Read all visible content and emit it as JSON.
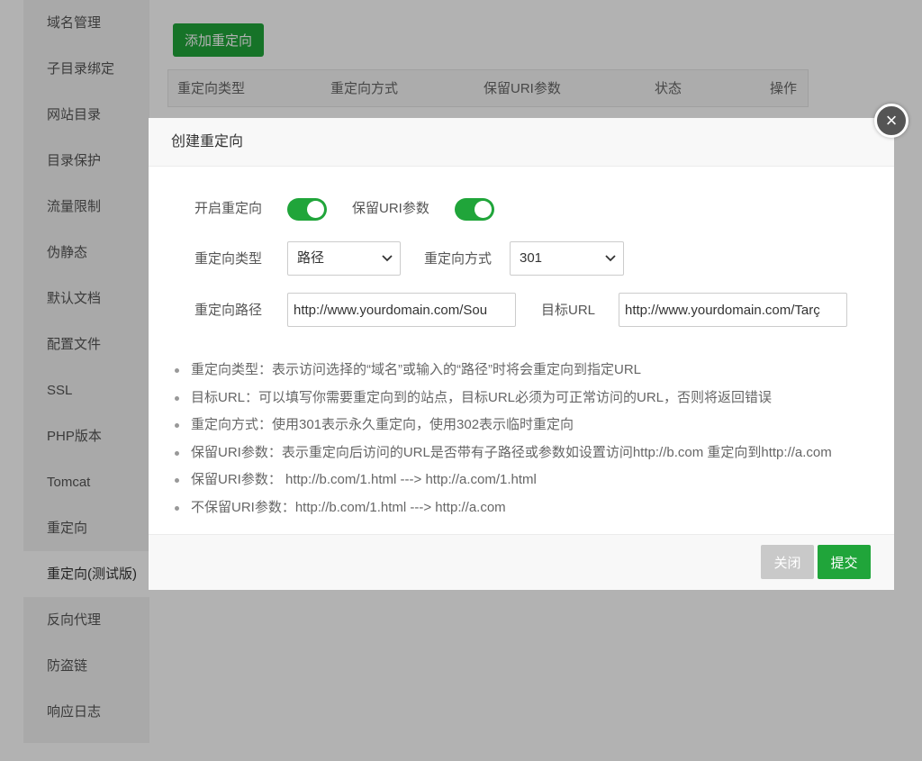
{
  "sidebar": {
    "items": [
      {
        "label": "域名管理",
        "name": "sidebar-item-domain"
      },
      {
        "label": "子目录绑定",
        "name": "sidebar-item-subdir-binding"
      },
      {
        "label": "网站目录",
        "name": "sidebar-item-site-dir"
      },
      {
        "label": "目录保护",
        "name": "sidebar-item-dir-protect"
      },
      {
        "label": "流量限制",
        "name": "sidebar-item-traffic-limit"
      },
      {
        "label": "伪静态",
        "name": "sidebar-item-rewrite"
      },
      {
        "label": "默认文档",
        "name": "sidebar-item-default-doc"
      },
      {
        "label": "配置文件",
        "name": "sidebar-item-config-file"
      },
      {
        "label": "SSL",
        "name": "sidebar-item-ssl"
      },
      {
        "label": "PHP版本",
        "name": "sidebar-item-php-version"
      },
      {
        "label": "Tomcat",
        "name": "sidebar-item-tomcat"
      },
      {
        "label": "重定向",
        "name": "sidebar-item-redirect"
      },
      {
        "label": "重定向(测试版)",
        "name": "sidebar-item-redirect-beta"
      },
      {
        "label": "反向代理",
        "name": "sidebar-item-reverse-proxy"
      },
      {
        "label": "防盗链",
        "name": "sidebar-item-hotlink"
      },
      {
        "label": "响应日志",
        "name": "sidebar-item-response-log"
      }
    ],
    "active_index": 12
  },
  "content": {
    "add_button": "添加重定向",
    "table_headers": [
      "重定向类型",
      "重定向方式",
      "保留URI参数",
      "状态",
      "操作"
    ]
  },
  "modal": {
    "title": "创建重定向",
    "enable_label": "开启重定向",
    "enable_on": true,
    "keep_uri_label": "保留URI参数",
    "keep_uri_on": true,
    "type_label": "重定向类型",
    "type_value": "路径",
    "method_label": "重定向方式",
    "method_value": "301",
    "path_label": "重定向路径",
    "path_value": "http://www.yourdomain.com/Sou",
    "target_label": "目标URL",
    "target_value": "http://www.yourdomain.com/Tarç",
    "notes": [
      "重定向类型：表示访问选择的“域名”或输入的“路径”时将会重定向到指定URL",
      "目标URL：可以填写你需要重定向到的站点，目标URL必须为可正常访问的URL，否则将返回错误",
      "重定向方式：使用301表示永久重定向，使用302表示临时重定向",
      "保留URI参数：表示重定向后访问的URL是否带有子路径或参数如设置访问http://b.com 重定向到http://a.com",
      "保留URI参数：  http://b.com/1.html ---> http://a.com/1.html",
      "不保留URI参数：http://b.com/1.html ---> http://a.com"
    ],
    "close_button": "关闭",
    "submit_button": "提交",
    "close_icon_glyph": "×"
  },
  "colors": {
    "accent": "#20a53a",
    "disabled": "#c9c9c9",
    "overlay": "rgba(0,0,0,0.3)"
  }
}
